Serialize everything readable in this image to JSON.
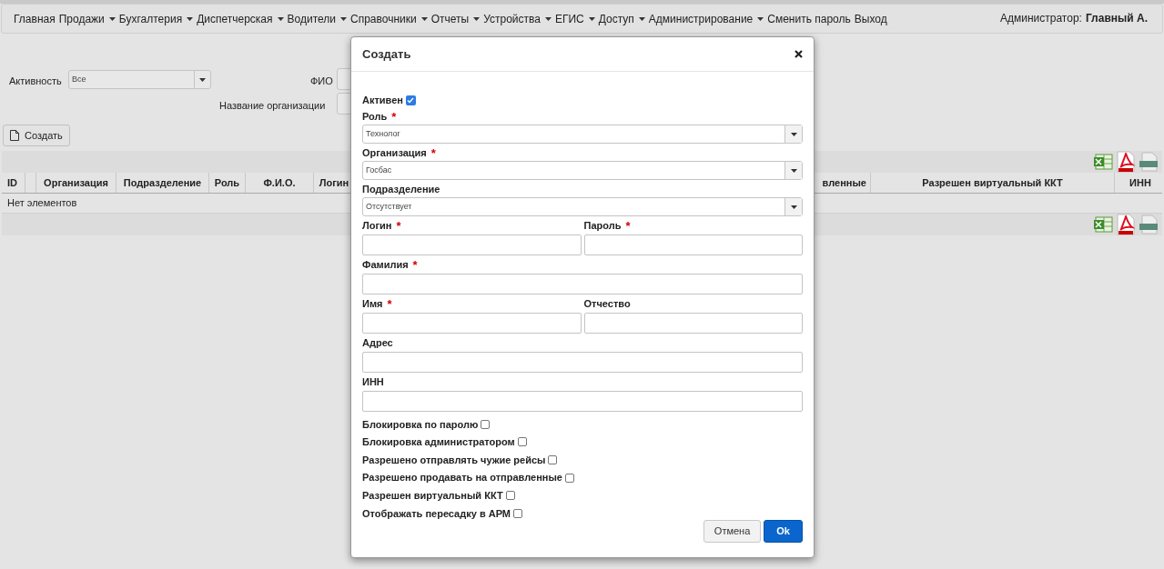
{
  "navbar": {
    "items": [
      {
        "label": "Главная",
        "dropdown": false
      },
      {
        "label": "Продажи",
        "dropdown": true
      },
      {
        "label": "Бухгалтерия",
        "dropdown": true
      },
      {
        "label": "Диспетчерская",
        "dropdown": true
      },
      {
        "label": "Водители",
        "dropdown": true
      },
      {
        "label": "Справочники",
        "dropdown": true
      },
      {
        "label": "Отчеты",
        "dropdown": true
      },
      {
        "label": "Устройства",
        "dropdown": true
      },
      {
        "label": "ЕГИС",
        "dropdown": true
      },
      {
        "label": "Доступ",
        "dropdown": true
      },
      {
        "label": "Администрирование",
        "dropdown": true
      },
      {
        "label": "Сменить пароль",
        "dropdown": false
      },
      {
        "label": "Выход",
        "dropdown": false
      }
    ],
    "user": {
      "role": "Администратор:",
      "name": "Главный А."
    }
  },
  "filters": {
    "activity": {
      "label": "Активность",
      "value": "Все"
    },
    "fio": {
      "label": "ФИО"
    },
    "organization_name": {
      "label": "Название организации"
    }
  },
  "create_button": {
    "label": "Создать"
  },
  "table": {
    "columns": [
      "ID",
      "",
      "Организация",
      "Подразделение",
      "Роль",
      "Ф.И.О.",
      "Логин",
      "вленные",
      "Разрешен виртуальный ККТ",
      "ИНН"
    ],
    "empty_text": "Нет элементов"
  },
  "dialog": {
    "title": "Создать",
    "active": {
      "label": "Активен",
      "checked": true
    },
    "rows": [
      [
        {
          "kind": "select",
          "label": "Роль",
          "required_mark": "*",
          "value": "Технолог"
        }
      ],
      [
        {
          "kind": "select",
          "label": "Организация",
          "required_mark": "*",
          "value": "Госбас"
        }
      ],
      [
        {
          "kind": "select",
          "label": "Подразделение",
          "value": "Отсутствует"
        }
      ],
      [
        {
          "kind": "input",
          "label": "Логин",
          "required_mark": "*"
        },
        {
          "kind": "input",
          "label": "Пароль",
          "required_mark": "*"
        }
      ],
      [
        {
          "kind": "input",
          "label": "Фамилия",
          "required_mark": "*"
        }
      ],
      [
        {
          "kind": "input",
          "label": "Имя",
          "required_mark": "*"
        },
        {
          "kind": "input",
          "label": "Отчество"
        }
      ],
      [
        {
          "kind": "input",
          "label": "Адрес"
        }
      ],
      [
        {
          "kind": "input",
          "label": "ИНН"
        }
      ]
    ],
    "checkboxes": [
      {
        "label": "Блокировка по паролю",
        "checked": false
      },
      {
        "label": "Блокировка администратором",
        "checked": false
      },
      {
        "label": "Разрешено отправлять чужие рейсы",
        "checked": false
      },
      {
        "label": "Разрешено продавать на отправленные",
        "checked": false
      },
      {
        "label": "Разрешен виртуальный ККТ",
        "checked": false
      },
      {
        "label": "Отображать пересадку в АРМ",
        "checked": false
      }
    ],
    "buttons": {
      "cancel": "Отмена",
      "ok": "Ok"
    }
  }
}
